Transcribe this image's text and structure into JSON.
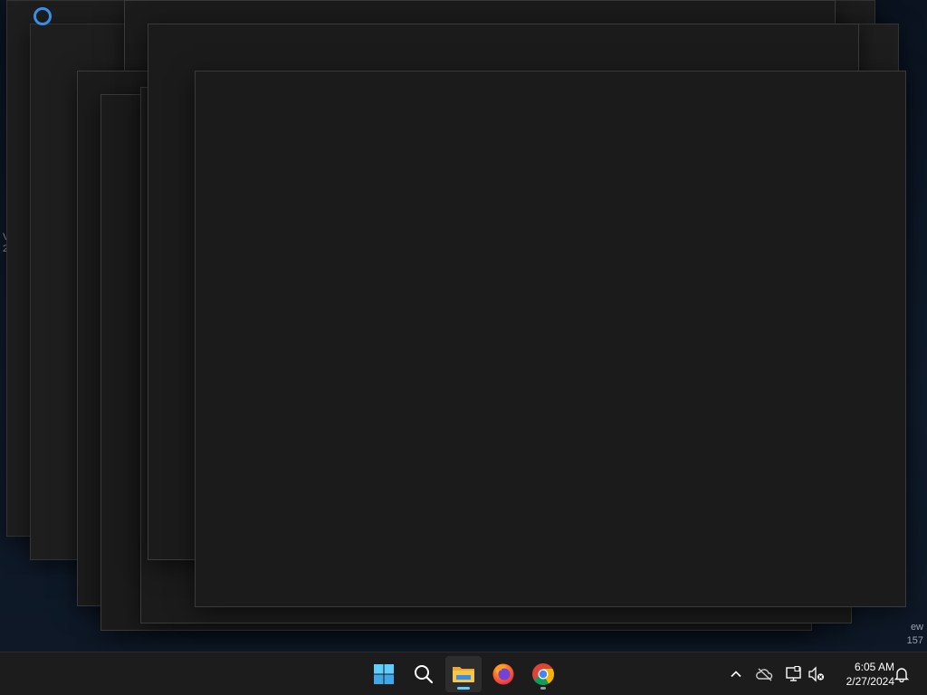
{
  "desktop": {
    "left_text": "V 2",
    "right_text_line1": "ew",
    "right_text_line2": "157"
  },
  "taskbar": {
    "apps": [
      {
        "name": "start",
        "label": "Start"
      },
      {
        "name": "search",
        "label": "Search"
      },
      {
        "name": "file-explorer",
        "label": "File Explorer",
        "active": true
      },
      {
        "name": "firefox",
        "label": "Firefox"
      },
      {
        "name": "chrome",
        "label": "Google Chrome",
        "running": true
      }
    ],
    "clock": {
      "time": "6:05 AM",
      "date": "2/27/2024"
    }
  },
  "colors": {
    "accent": "#60cdff",
    "window_bg": "#1b1b1b",
    "taskbar_bg": "#1c1c1c",
    "spinner": "#3a8ee6"
  }
}
